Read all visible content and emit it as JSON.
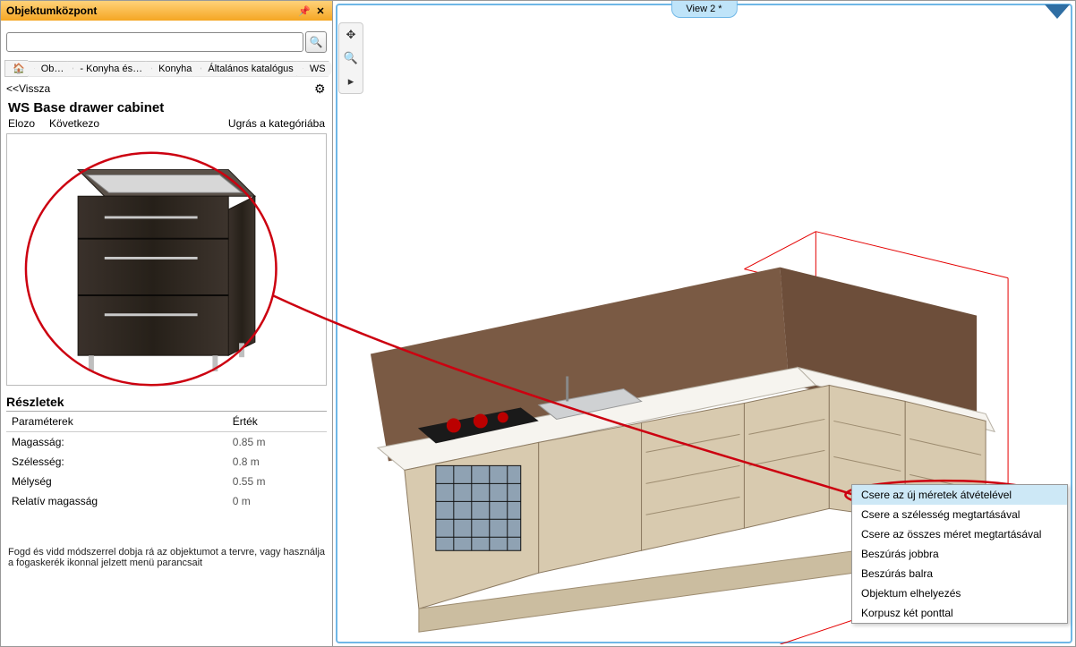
{
  "sidebar": {
    "title": "Objektumközpont",
    "search_placeholder": "",
    "breadcrumb": [
      "",
      "Ob…",
      "- Konyha és…",
      "Konyha",
      "Általános katalógus",
      "WS"
    ],
    "back_label": "<<Vissza",
    "object_title": "WS Base drawer cabinet",
    "nav_prev": "Elozo",
    "nav_next": "Következo",
    "nav_jump": "Ugrás a kategóriába",
    "details_header": "Részletek",
    "col_param": "Paraméterek",
    "col_value": "Érték",
    "rows": [
      {
        "k": "Magasság:",
        "v": "0.85 m"
      },
      {
        "k": "Szélesség:",
        "v": "0.8 m"
      },
      {
        "k": "Mélység",
        "v": "0.55 m"
      },
      {
        "k": "Relatív magasság",
        "v": "0 m"
      }
    ],
    "hint": "Fogd és vidd módszerrel dobja rá az objektumot a tervre, vagy használja a fogaskerék ikonnal jelzett menü parancsait"
  },
  "viewport": {
    "tab_label": "View 2 *"
  },
  "context_menu": {
    "items": [
      "Csere az új méretek átvételével",
      "Csere a szélesség megtartásával",
      "Csere az összes méret megtartásával",
      "Beszúrás jobbra",
      "Beszúrás balra",
      "Objektum elhelyezés",
      "Korpusz két ponttal"
    ],
    "highlighted_index": 0
  }
}
